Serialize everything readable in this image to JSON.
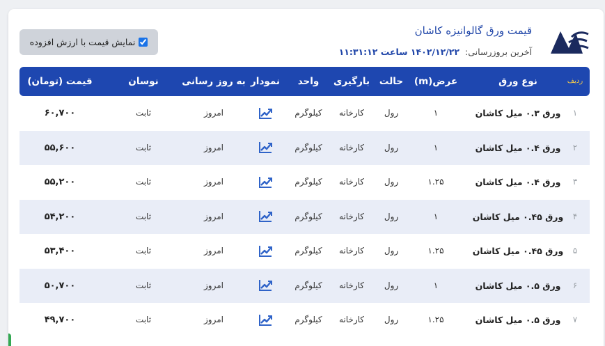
{
  "header": {
    "title": "قیمت ورق گالوانیزه کاشان",
    "update_label": "آخرین بروزرسانی:",
    "update_stamp": "۱۴۰۲/۱۲/۲۲ ساعت ۱۱:۳۱:۱۲",
    "vat_label": "نمایش قیمت با ارزش افزوده",
    "vat_checked": true
  },
  "table": {
    "columns": {
      "rownum": "ردیف",
      "type": "نوع ورق",
      "width": "عرض(m)",
      "state": "حالت",
      "loading": "بارگیری",
      "unit": "واحد",
      "chart": "نمودار",
      "updated": "به روز رسانی",
      "change": "نوسان",
      "price": "قیمت (تومان)"
    },
    "rows": [
      {
        "num": "۱",
        "type": "ورق ۰.۳ میل کاشان",
        "width": "۱",
        "state": "رول",
        "loading": "کارخانه",
        "unit": "کیلوگرم",
        "updated": "امروز",
        "change": "ثابت",
        "price": "۶۰,۷۰۰"
      },
      {
        "num": "۲",
        "type": "ورق ۰.۴ میل کاشان",
        "width": "۱",
        "state": "رول",
        "loading": "کارخانه",
        "unit": "کیلوگرم",
        "updated": "امروز",
        "change": "ثابت",
        "price": "۵۵,۶۰۰"
      },
      {
        "num": "۳",
        "type": "ورق ۰.۴ میل کاشان",
        "width": "۱.۲۵",
        "state": "رول",
        "loading": "کارخانه",
        "unit": "کیلوگرم",
        "updated": "امروز",
        "change": "ثابت",
        "price": "۵۵,۲۰۰"
      },
      {
        "num": "۴",
        "type": "ورق ۰.۴۵ میل کاشان",
        "width": "۱",
        "state": "رول",
        "loading": "کارخانه",
        "unit": "کیلوگرم",
        "updated": "امروز",
        "change": "ثابت",
        "price": "۵۴,۲۰۰"
      },
      {
        "num": "۵",
        "type": "ورق ۰.۴۵ میل کاشان",
        "width": "۱.۲۵",
        "state": "رول",
        "loading": "کارخانه",
        "unit": "کیلوگرم",
        "updated": "امروز",
        "change": "ثابت",
        "price": "۵۳,۴۰۰"
      },
      {
        "num": "۶",
        "type": "ورق ۰.۵ میل کاشان",
        "width": "۱",
        "state": "رول",
        "loading": "کارخانه",
        "unit": "کیلوگرم",
        "updated": "امروز",
        "change": "ثابت",
        "price": "۵۰,۷۰۰"
      },
      {
        "num": "۷",
        "type": "ورق ۰.۵ میل کاشان",
        "width": "۱.۲۵",
        "state": "رول",
        "loading": "کارخانه",
        "unit": "کیلوگرم",
        "updated": "امروز",
        "change": "ثابت",
        "price": "۴۹,۷۰۰"
      }
    ]
  },
  "icons": {
    "chart": "chart-line-icon",
    "logo": "brand-logo-icon"
  },
  "colors": {
    "header_bg": "#1e47b0",
    "accent": "#1f45a8",
    "row_alt": "#e9edf7",
    "chart_icon": "#2f63c8"
  }
}
